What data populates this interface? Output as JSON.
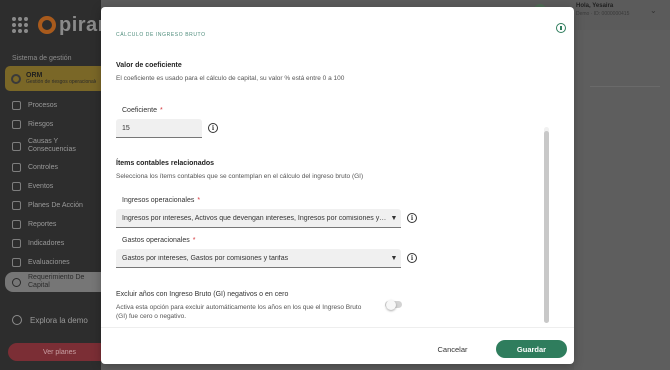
{
  "app": {
    "logo_text": "piran",
    "section_label": "Sistema de gestión",
    "orm": {
      "title": "ORM",
      "subtitle": "Gestión de riesgos operacionales"
    },
    "nav": [
      {
        "label": "Procesos",
        "icon": "process-icon"
      },
      {
        "label": "Riesgos",
        "icon": "alert-icon"
      },
      {
        "label": "Causas Y Consecuencias",
        "icon": "causes-icon"
      },
      {
        "label": "Controles",
        "icon": "sliders-icon"
      },
      {
        "label": "Eventos",
        "icon": "events-icon"
      },
      {
        "label": "Planes De Acción",
        "icon": "checklist-icon"
      },
      {
        "label": "Reportes",
        "icon": "report-icon"
      },
      {
        "label": "Indicadores",
        "icon": "indicator-icon"
      },
      {
        "label": "Evaluaciones",
        "icon": "evaluation-icon"
      },
      {
        "label": "Requerimiento De Capital",
        "icon": "capital-icon"
      }
    ],
    "explore_label": "Explora la demo",
    "plans_label": "Ver planes",
    "user": {
      "name": "Hola, Yesaira",
      "meta": "Demo · ID: 0000000415"
    }
  },
  "modal": {
    "title": "CÁLCULO DE INGRESO BRUTO",
    "coef_section": {
      "title": "Valor de coeficiente",
      "description": "El coeficiente es usado para el cálculo de capital, su valor % está entre 0 a 100"
    },
    "coef_field": {
      "label": "Coeficiente",
      "required_mark": "*",
      "value": "15"
    },
    "items_section": {
      "title": "Ítems contables relacionados",
      "description": "Selecciona los ítems contables que se contemplan en el cálculo del ingreso bruto (GI)"
    },
    "ingresos_field": {
      "label": "Ingresos operacionales",
      "required_mark": "*",
      "value": "Ingresos por intereses, Activos que devengan intereses, Ingresos por comisiones y tarifas"
    },
    "gastos_field": {
      "label": "Gastos operacionales",
      "required_mark": "*",
      "value": "Gastos por intereses, Gastos por comisiones y tarifas"
    },
    "exclude_toggle": {
      "title": "Excluir años con Ingreso Bruto (GI) negativos o en cero",
      "description_line1": "Activa esta opción para excluir automáticamente los años en los que el Ingreso Bruto",
      "description_line2": "(GI) fue cero o negativo.",
      "enabled": false
    },
    "cancel_label": "Cancelar",
    "save_label": "Guardar"
  },
  "colors": {
    "primary": "#2f7d5d",
    "required": "#d4343a",
    "orm_card": "#7a6727",
    "plans_button": "#7b2e35"
  }
}
